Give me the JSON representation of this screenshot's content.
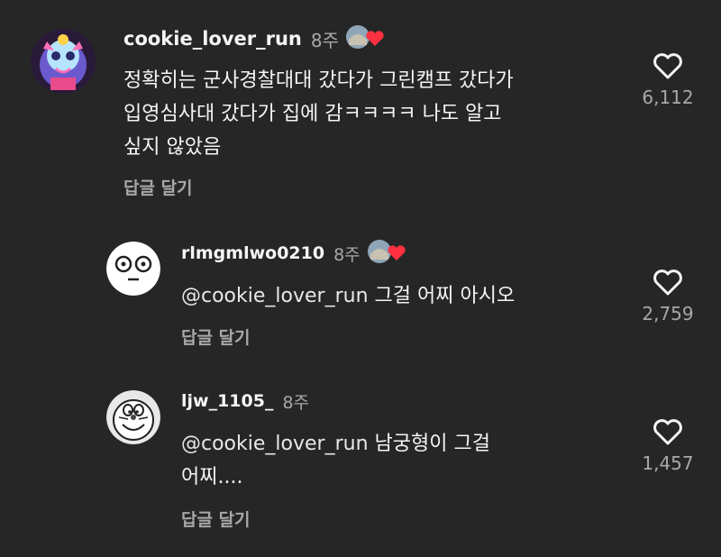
{
  "comments": [
    {
      "username": "cookie_lover_run",
      "time": "8주",
      "text_lines": [
        "정확히는 군사경찰대대 갔다가 그린캠프 갔다가",
        "입영심사대 갔다가 집에 감ㅋㅋㅋㅋ 나도 알고",
        "싶지 않았음"
      ],
      "reply_label": "답글 달기",
      "likes": "6,112"
    },
    {
      "username": "rlmgmlwo0210",
      "time": "8주",
      "mention": "@cookie_lover_run",
      "text_lines": [
        "그걸 어찌 아시오"
      ],
      "reply_label": "답글 달기",
      "likes": "2,759"
    },
    {
      "username": "ljw_1105_",
      "time": "8주",
      "mention": "@cookie_lover_run",
      "text_lines": [
        "남궁형이 그걸",
        "어찌...."
      ],
      "reply_label": "답글 달기",
      "likes": "1,457"
    }
  ],
  "colors": {
    "background": "#262626",
    "text": "#f5f5f5",
    "secondary": "#a8a8a8",
    "heart_badge": "#ff3040"
  }
}
